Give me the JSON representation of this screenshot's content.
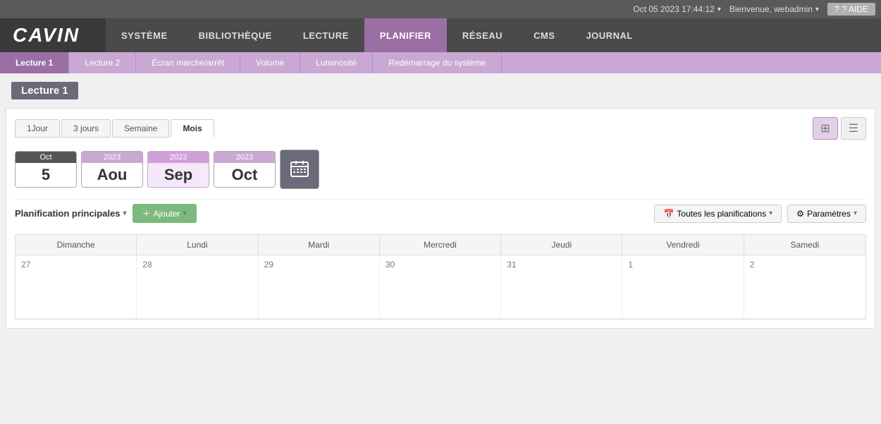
{
  "topbar": {
    "datetime": "Oct 05 2023 17:44:12",
    "welcome": "Bienvenue, webadmin",
    "aide": "? AIDE"
  },
  "logo": "CAVIN",
  "nav": {
    "items": [
      {
        "label": "SYSTÈME",
        "active": false
      },
      {
        "label": "BIBLIOTHÈQUE",
        "active": false
      },
      {
        "label": "LECTURE",
        "active": false
      },
      {
        "label": "PLANIFIER",
        "active": true
      },
      {
        "label": "RÉSEAU",
        "active": false
      },
      {
        "label": "CMS",
        "active": false
      },
      {
        "label": "JOURNAL",
        "active": false
      }
    ]
  },
  "subnav": {
    "items": [
      {
        "label": "Lecture 1",
        "active": true
      },
      {
        "label": "Lecture 2",
        "active": false
      },
      {
        "label": "Écran marche/arrêt",
        "active": false
      },
      {
        "label": "Volume",
        "active": false
      },
      {
        "label": "Luminosité",
        "active": false
      },
      {
        "label": "Redémarrage du système",
        "active": false
      }
    ]
  },
  "page_title": "Lecture 1",
  "view_tabs": {
    "tabs": [
      {
        "label": "1Jour",
        "active": false
      },
      {
        "label": "3 jours",
        "active": false
      },
      {
        "label": "Semaine",
        "active": false
      },
      {
        "label": "Mois",
        "active": true
      }
    ]
  },
  "date_cards": [
    {
      "top": "Oct",
      "bottom": "5",
      "style": "dark"
    },
    {
      "top": "2023",
      "bottom": "Aou",
      "style": "purple"
    },
    {
      "top": "2023",
      "bottom": "Sep",
      "style": "purple-light"
    },
    {
      "top": "2023",
      "bottom": "Oct",
      "style": "purple"
    }
  ],
  "toolbar": {
    "planif_label": "Planification principales",
    "add_label": "Ajouter",
    "toutes_label": "Toutes les planifications",
    "params_label": "Paramètres"
  },
  "calendar": {
    "headers": [
      "Dimanche",
      "Lundi",
      "Mardi",
      "Mercredi",
      "Jeudi",
      "Vendredi",
      "Samedi"
    ],
    "rows": [
      [
        {
          "day": "27"
        },
        {
          "day": "28"
        },
        {
          "day": "29"
        },
        {
          "day": "30"
        },
        {
          "day": "31"
        },
        {
          "day": "1"
        },
        {
          "day": "2"
        }
      ]
    ]
  }
}
